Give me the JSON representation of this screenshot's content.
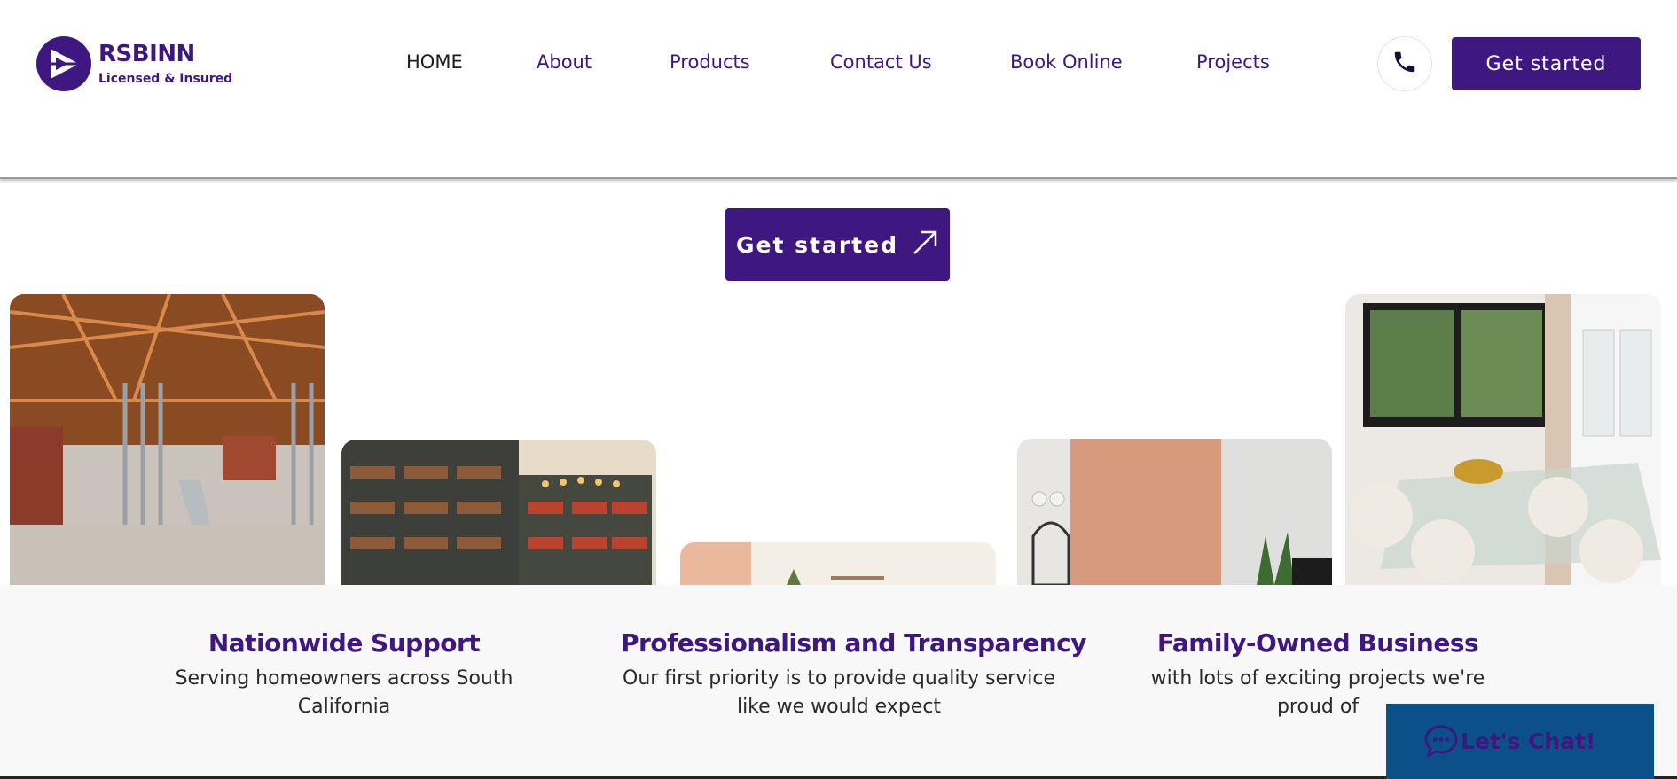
{
  "brand": {
    "name": "RSBINN",
    "tagline": "Licensed & Insured"
  },
  "nav": [
    {
      "label": "HOME",
      "active": true
    },
    {
      "label": "About"
    },
    {
      "label": "Products"
    },
    {
      "label": "Contact Us"
    },
    {
      "label": "Book Online"
    },
    {
      "label": "Projects"
    }
  ],
  "header": {
    "phone_icon": "phone-icon",
    "cta_label": "Get started"
  },
  "hero": {
    "cta_label": "Get started",
    "cta_icon": "arrow-up-right-icon"
  },
  "gallery": [
    {
      "name": "construction-framing-photo"
    },
    {
      "name": "library-bookshelves-photo"
    },
    {
      "name": "interior-wall-photo"
    },
    {
      "name": "bathroom-vanity-photo"
    },
    {
      "name": "dining-room-photo"
    }
  ],
  "features": [
    {
      "title": "Nationwide Support",
      "desc": "Serving homeowners across South California"
    },
    {
      "title": "Professionalism and Transparency",
      "desc": "Our first priority is to provide quality service like we would expect"
    },
    {
      "title": "Family-Owned Business",
      "desc": "with lots of exciting projects we're proud of"
    }
  ],
  "chat": {
    "label": "Let's Chat!",
    "icon": "chat-bubble-icon"
  },
  "colors": {
    "brand": "#3f1781",
    "chat_bg": "#0b5089",
    "band_bg": "#f8f8f8"
  }
}
